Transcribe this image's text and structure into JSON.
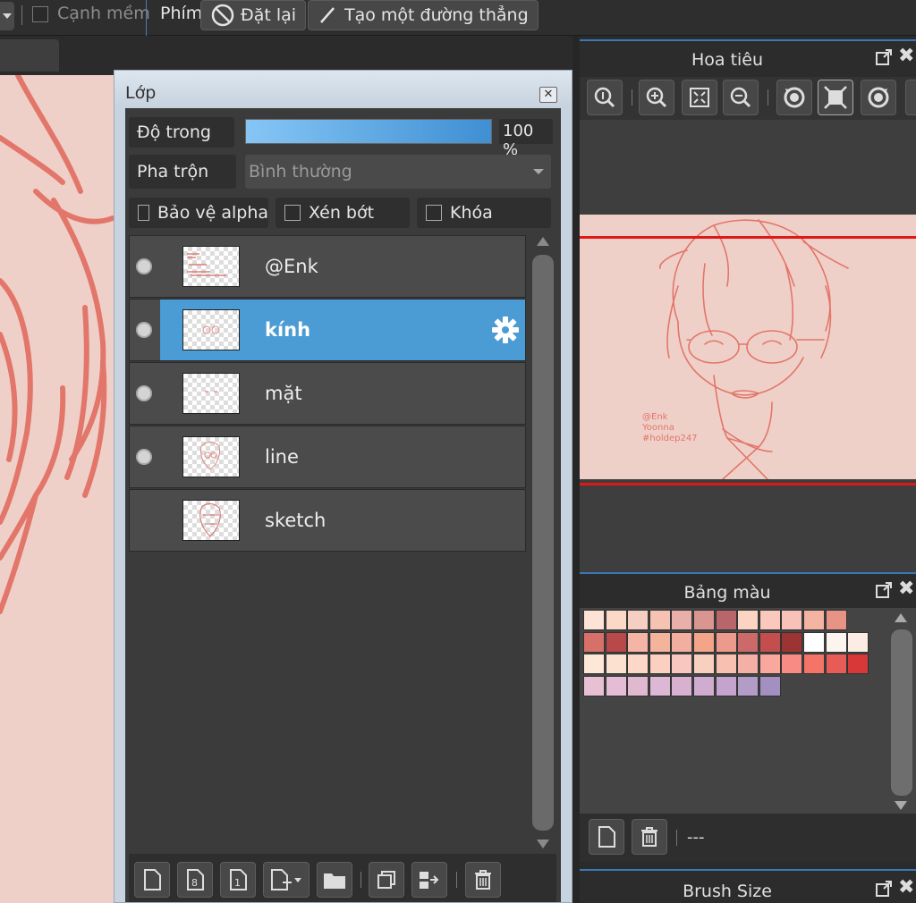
{
  "toolbar": {
    "soft_edge_label": "Cạnh mềm",
    "keys_label": "Phím",
    "reset_label": "Đặt lại",
    "line_label": "Tạo một đường thẳng"
  },
  "layer_panel": {
    "title": "Lớp",
    "opacity_label": "Độ trong",
    "opacity_value": "100 %",
    "opacity_fraction": 1.0,
    "blend_label": "Pha trộn",
    "blend_value": "Bình thường",
    "protect_alpha_label": "Bảo vệ alpha",
    "clipping_label": "Xén bớt",
    "lock_label": "Khóa",
    "layers": [
      {
        "name": "@Enk",
        "visible": true,
        "active": false
      },
      {
        "name": "kính",
        "visible": true,
        "active": true
      },
      {
        "name": "mặt",
        "visible": true,
        "active": false
      },
      {
        "name": "line",
        "visible": true,
        "active": false
      },
      {
        "name": "sketch",
        "visible": false,
        "active": false
      }
    ]
  },
  "navigator": {
    "title": "Hoa tiêu",
    "watermark_lines": [
      "@Enk",
      "Yoonna",
      "#holdep247"
    ]
  },
  "palette": {
    "title": "Bảng màu",
    "name": "---",
    "colors": [
      [
        "#fde3d6",
        "#fcd9c6",
        "#f5cfc2",
        "#f6c2b2",
        "#e8b0a8",
        "#d9958f",
        "#b8666a",
        "#fcd4c4",
        "#fac8bc",
        "#f8c2b8",
        "#f4b4a2",
        "#e79486"
      ],
      [
        "#d77068",
        "#b8484a",
        "#f4b4a6",
        "#f4b49c",
        "#f2ae9e",
        "#f4a488",
        "#ec9a8c",
        "#cc6a6a",
        "#c44e4e",
        "#9c3434",
        "#ffffff",
        "#fcf4ee",
        "#fcede4"
      ],
      [
        "#fde8d8",
        "#fce0d0",
        "#fcd8c8",
        "#fcd0c0",
        "#f8c8c0",
        "#f8d0c0",
        "#f8c0b0",
        "#f4b0a4",
        "#f8a89c",
        "#f88c84",
        "#f47468",
        "#e85c58",
        "#d83838"
      ],
      [
        "#e8c0d4",
        "#e4bcd4",
        "#e0b8d0",
        "#dcb8d4",
        "#d8b0d0",
        "#d0acd0",
        "#c4a4cc",
        "#b49cc8",
        "#a490c0"
      ]
    ]
  },
  "brush_size": {
    "title": "Brush Size"
  },
  "colors": {
    "accent": "#4b9bd4",
    "canvas": "#efd0c8",
    "line": "#e2766a",
    "frame": "#e01818"
  }
}
